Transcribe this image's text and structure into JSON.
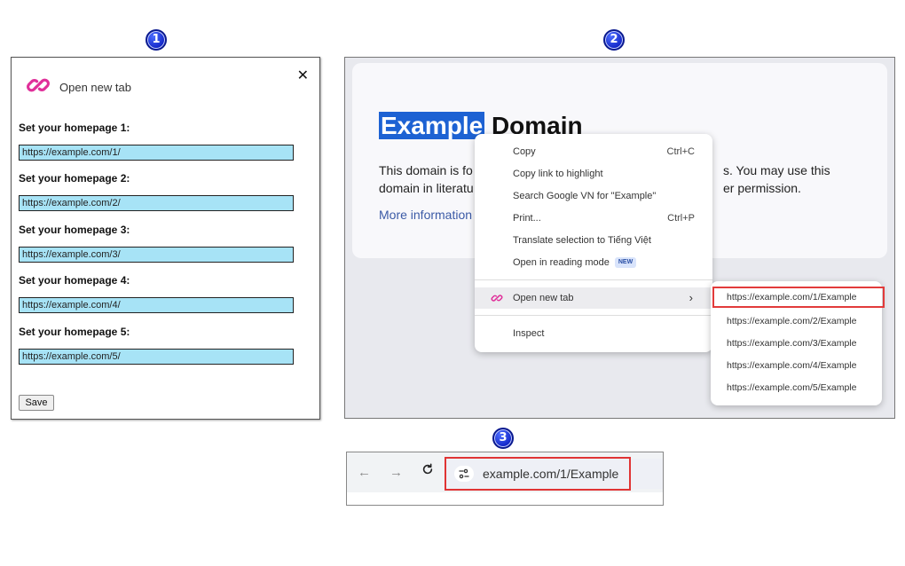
{
  "steps": [
    "1",
    "2",
    "3"
  ],
  "options_panel": {
    "title": "Open new tab",
    "close_glyph": "✕",
    "fields": [
      {
        "label": "Set your homepage 1:",
        "value": "https://example.com/1/"
      },
      {
        "label": "Set your homepage 2:",
        "value": "https://example.com/2/"
      },
      {
        "label": "Set your homepage 3:",
        "value": "https://example.com/3/"
      },
      {
        "label": "Set your homepage 4:",
        "value": "https://example.com/4/"
      },
      {
        "label": "Set your homepage 5:",
        "value": "https://example.com/5/"
      }
    ],
    "save_label": "Save"
  },
  "page": {
    "heading_selected": "Example",
    "heading_rest": " Domain",
    "para_line1": "This domain is fo",
    "para_line1_end": "s. You may use this",
    "para_line2": "domain in literatu",
    "para_line2_end": "er permission.",
    "more_link": "More information"
  },
  "context_menu": {
    "items": [
      {
        "label": "Copy",
        "shortcut": "Ctrl+C"
      },
      {
        "label": "Copy link to highlight",
        "shortcut": ""
      },
      {
        "label": "Search Google VN for \"Example\"",
        "shortcut": ""
      },
      {
        "label": "Print...",
        "shortcut": "Ctrl+P"
      },
      {
        "label": "Translate selection to Tiếng Việt",
        "shortcut": ""
      },
      {
        "label": "Open in reading mode",
        "shortcut": "",
        "badge": "NEW"
      }
    ],
    "open_new_tab": {
      "label": "Open new tab",
      "arrow": "›"
    },
    "inspect": "Inspect"
  },
  "submenu": {
    "items": [
      "https://example.com/1/Example",
      "https://example.com/2/Example",
      "https://example.com/3/Example",
      "https://example.com/4/Example",
      "https://example.com/5/Example"
    ]
  },
  "browser": {
    "back_glyph": "←",
    "forward_glyph": "→",
    "reload_glyph": "C",
    "url": "example.com/1/Example"
  },
  "colors": {
    "accent_pink": "#e0309a",
    "selection_blue": "#1d62d3",
    "highlight_red": "#e03434",
    "input_bg": "#a7e3f6"
  },
  "icons": {
    "link": "link-icon",
    "close": "close-icon",
    "site_settings": "tune-icon"
  }
}
